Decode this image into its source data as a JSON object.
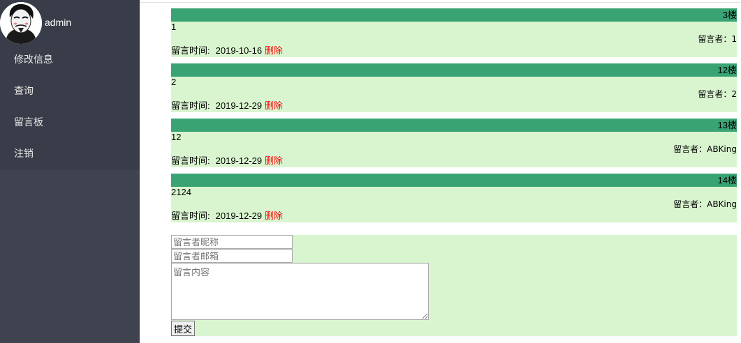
{
  "user": {
    "name": "admin"
  },
  "menu": {
    "items": [
      {
        "label": "修改信息"
      },
      {
        "label": "查询"
      },
      {
        "label": "留言板"
      },
      {
        "label": "注销"
      }
    ]
  },
  "messages": [
    {
      "floor": "3楼",
      "content": "1",
      "author": "留言者：1",
      "time_label": "留言时间:",
      "time": "2019-10-16",
      "delete": "删除"
    },
    {
      "floor": "12楼",
      "content": "2",
      "author": "留言者：2",
      "time_label": "留言时间:",
      "time": "2019-12-29",
      "delete": "删除"
    },
    {
      "floor": "13楼",
      "content": "12",
      "author": "留言者：ABKing",
      "time_label": "留言时间:",
      "time": "2019-12-29",
      "delete": "删除"
    },
    {
      "floor": "14楼",
      "content": "2124",
      "author": "留言者：ABKing",
      "time_label": "留言时间:",
      "time": "2019-12-29",
      "delete": "删除"
    }
  ],
  "form": {
    "nickname_placeholder": "留言者昵称",
    "email_placeholder": "留言者邮箱",
    "content_placeholder": "留言内容",
    "submit_label": "提交"
  },
  "colors": {
    "sidebar": "#3f4350",
    "menu": "#393d49",
    "floor_header": "#3aa374",
    "message_bg": "#d9f5cf",
    "delete_link": "#ff0000"
  },
  "icons": {
    "avatar": "masked-user-avatar"
  }
}
